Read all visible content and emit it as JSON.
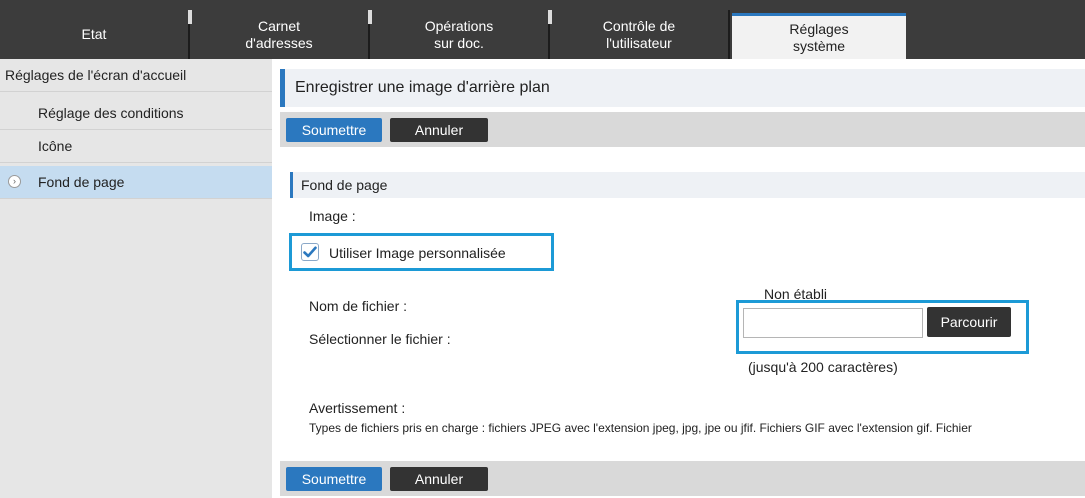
{
  "tabs": [
    {
      "label": "Etat"
    },
    {
      "label": "Carnet\nd'adresses"
    },
    {
      "label": "Opérations\nsur doc."
    },
    {
      "label": "Contrôle de\nl'utilisateur"
    },
    {
      "label": "Réglages\nsystème",
      "active": true
    }
  ],
  "sidebar": {
    "items": [
      {
        "label": "Réglages de l'écran d'accueil"
      },
      {
        "label": "Réglage des conditions"
      },
      {
        "label": "Icône"
      },
      {
        "label": "Fond de page",
        "active": true
      }
    ]
  },
  "main": {
    "title": "Enregistrer une image d'arrière plan",
    "submit_label": "Soumettre",
    "cancel_label": "Annuler",
    "section_title": "Fond de page",
    "image_label": "Image :",
    "use_custom_image_label": "Utiliser Image personnalisée",
    "use_custom_image_checked": true,
    "filename_label": "Nom de fichier :",
    "filename_value": "Non établi",
    "select_file_label": "Sélectionner le fichier :",
    "file_input_value": "",
    "browse_label": "Parcourir",
    "char_limit_note": "(jusqu'à 200 caractères)",
    "warning_label": "Avertissement :",
    "warning_text": "Types de fichiers pris en charge : fichiers JPEG avec l'extension jpeg, jpg, jpe ou jfif. Fichiers GIF avec l'extension gif. Fichier"
  },
  "colors": {
    "accent": "#2b78bf",
    "highlight": "#1c9ad6",
    "tabbar": "#3c3c3c",
    "sidebar": "#e6e6e6",
    "sidebar_active": "#c5dcf0"
  }
}
